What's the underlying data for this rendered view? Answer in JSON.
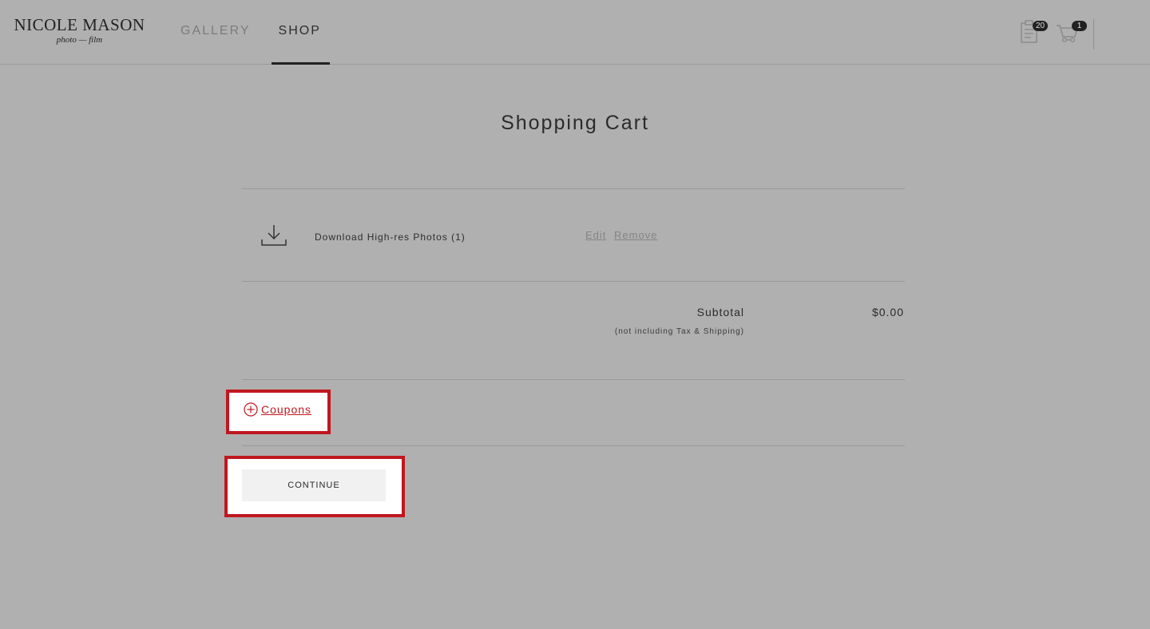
{
  "header": {
    "logo_name": "NICOLE MASON",
    "logo_sub": "photo — film",
    "nav": [
      {
        "label": "GALLERY",
        "active": false
      },
      {
        "label": "SHOP",
        "active": true
      }
    ],
    "orders_badge": "20",
    "cart_badge": "1"
  },
  "page": {
    "title": "Shopping Cart"
  },
  "cart": {
    "items": [
      {
        "icon": "download-icon",
        "label": "Download High-res Photos (1)",
        "edit_label": "Edit",
        "remove_label": "Remove"
      }
    ],
    "subtotal_label": "Subtotal",
    "subtotal_note": "(not including Tax & Shipping)",
    "subtotal_value": "$0.00"
  },
  "coupons": {
    "icon": "plus-circle-icon",
    "label": "Coupons"
  },
  "actions": {
    "continue_label": "CONTINUE"
  },
  "colors": {
    "page_background": "#b0b0b0",
    "highlight_red": "#c0171f",
    "button_background": "#f1f1f1"
  }
}
